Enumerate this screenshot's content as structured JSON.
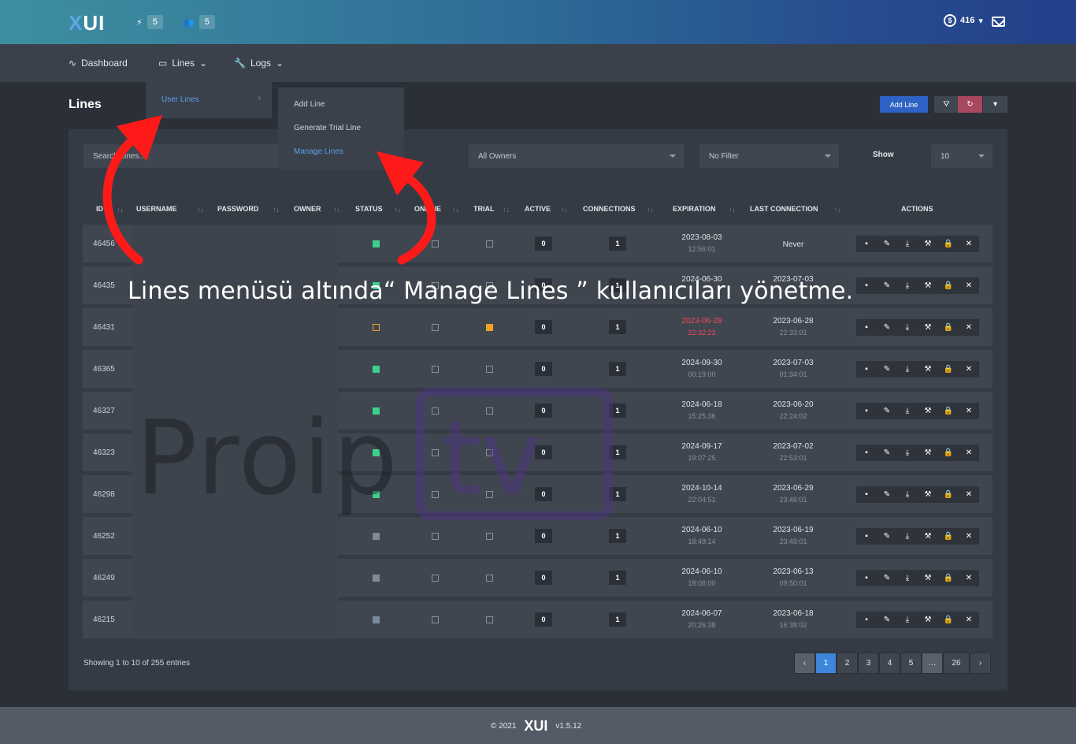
{
  "header": {
    "logo": "XUI",
    "logo_x": "X",
    "logo_rest": "UI",
    "stat_connections": "5",
    "stat_users": "5",
    "credits_icon": "$",
    "credits": "416"
  },
  "nav": {
    "dashboard": "Dashboard",
    "lines": "Lines",
    "logs": "Logs"
  },
  "lines_menu": {
    "user_lines": "User Lines",
    "submenu": [
      "Add Line",
      "Generate Trial Line",
      "Manage Lines"
    ]
  },
  "page": {
    "title": "Lines",
    "add_button": "Add Line"
  },
  "filters": {
    "search_placeholder": "Search Lines...",
    "owners": "All Owners",
    "filter": "No Filter",
    "show_label": "Show",
    "show_value": "10"
  },
  "table": {
    "columns": [
      "ID",
      "USERNAME",
      "PASSWORD",
      "OWNER",
      "STATUS",
      "ONLINE",
      "TRIAL",
      "ACTIVE",
      "CONNECTIONS",
      "EXPIRATION",
      "LAST CONNECTION",
      "ACTIONS"
    ],
    "rows": [
      {
        "id": "46456",
        "status": "green",
        "trial": false,
        "active": "0",
        "conn": "1",
        "exp_date": "2023-08-03",
        "exp_time": "12:56:01",
        "last_date": "Never",
        "last_time": "",
        "expired": false
      },
      {
        "id": "46435",
        "status": "green",
        "trial": false,
        "active": "0",
        "conn": "1",
        "exp_date": "2024-06-30",
        "exp_time": "",
        "last_date": "2023-07-03",
        "last_time": "",
        "expired": false
      },
      {
        "id": "46431",
        "status": "orange",
        "trial": true,
        "active": "0",
        "conn": "1",
        "exp_date": "2023-06-28",
        "exp_time": "22:32:23",
        "last_date": "2023-06-28",
        "last_time": "22:33:01",
        "expired": true
      },
      {
        "id": "46365",
        "status": "green",
        "trial": false,
        "active": "0",
        "conn": "1",
        "exp_date": "2024-09-30",
        "exp_time": "00:19:00",
        "last_date": "2023-07-03",
        "last_time": "01:34:01",
        "expired": false
      },
      {
        "id": "46327",
        "status": "green",
        "trial": false,
        "active": "0",
        "conn": "1",
        "exp_date": "2024-06-18",
        "exp_time": "15:25:36",
        "last_date": "2023-06-20",
        "last_time": "22:24:02",
        "expired": false
      },
      {
        "id": "46323",
        "status": "green",
        "trial": false,
        "active": "0",
        "conn": "1",
        "exp_date": "2024-09-17",
        "exp_time": "19:07:25",
        "last_date": "2023-07-02",
        "last_time": "22:53:01",
        "expired": false
      },
      {
        "id": "46298",
        "status": "green",
        "trial": false,
        "active": "0",
        "conn": "1",
        "exp_date": "2024-10-14",
        "exp_time": "22:04:51",
        "last_date": "2023-06-29",
        "last_time": "23:46:01",
        "expired": false
      },
      {
        "id": "46252",
        "status": "gray",
        "trial": false,
        "active": "0",
        "conn": "1",
        "exp_date": "2024-06-10",
        "exp_time": "18:49:14",
        "last_date": "2023-06-19",
        "last_time": "23:49:01",
        "expired": false
      },
      {
        "id": "46249",
        "status": "gray",
        "trial": false,
        "active": "0",
        "conn": "1",
        "exp_date": "2024-06-10",
        "exp_time": "18:08:00",
        "last_date": "2023-06-13",
        "last_time": "09:50:01",
        "expired": false
      },
      {
        "id": "46215",
        "status": "gray",
        "trial": false,
        "active": "0",
        "conn": "1",
        "exp_date": "2024-06-07",
        "exp_time": "20:26:38",
        "last_date": "2023-06-18",
        "last_time": "16:38:02",
        "expired": false
      }
    ],
    "action_icons": [
      "file-icon",
      "pencil-icon",
      "download-icon",
      "hammer-icon",
      "lock-icon",
      "close-icon"
    ]
  },
  "pagination": {
    "showing": "Showing 1 to 10 of 255 entries",
    "prev": "‹",
    "pages": [
      "1",
      "2",
      "3",
      "4",
      "5",
      "…",
      "26"
    ],
    "next": "›"
  },
  "footer": {
    "copyright": "© 2021",
    "logo": "XUI",
    "version": "v1.5.12"
  },
  "overlay": {
    "caption": "Lines menüsü altında“ Manage Lines ” kullanıcıları yönetme.",
    "watermark_left": "Proip",
    "watermark_right": "tv"
  },
  "colors": {
    "status_green": "#3ecf8e",
    "status_orange": "#f0a224",
    "status_gray": "#7d8a9a",
    "expired_red": "#f0485a",
    "accent_blue": "#2e62c4",
    "arrow_red": "#ff1a1a"
  }
}
